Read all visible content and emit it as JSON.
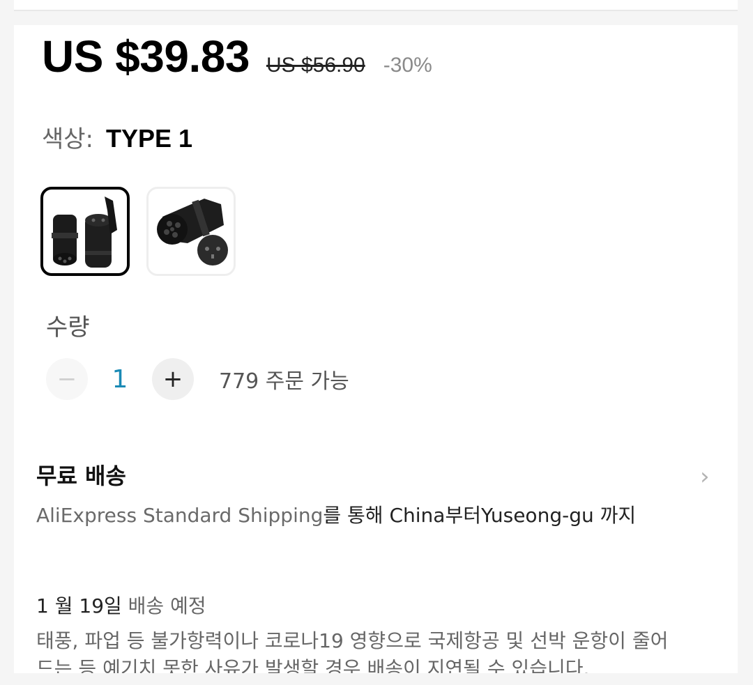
{
  "price": {
    "current": "US $39.83",
    "original": "US $56.90",
    "discount": "-30%"
  },
  "color": {
    "label": "색상:",
    "value": "TYPE 1",
    "options": [
      {
        "name": "type-1-adapter",
        "selected": true
      },
      {
        "name": "type-2-adapter-with-socket",
        "selected": false
      }
    ]
  },
  "quantity": {
    "label": "수량",
    "minus": "−",
    "value": "1",
    "plus": "+",
    "available": "779 주문 가능"
  },
  "shipping": {
    "title": "무료 배송",
    "chevron": "›",
    "method": "AliExpress Standard Shipping",
    "via_text": "를 통해 ",
    "origin": "China",
    "from_text": "부터",
    "destination": "Yuseong-gu",
    "to_text": " 까지"
  },
  "delivery": {
    "date": "1 월 19일",
    "label": " 배송 예정",
    "notice": "태풍, 파업 등 불가항력이나 코로나19 영향으로 국제항공 및 선박 운항이 줄어드는 등 예기치 못한 사유가 발생할 경우 배송이 지연될 수 있습니다."
  },
  "colors": {
    "qty_value": "#1a8ab5",
    "selected_border": "#000000"
  }
}
